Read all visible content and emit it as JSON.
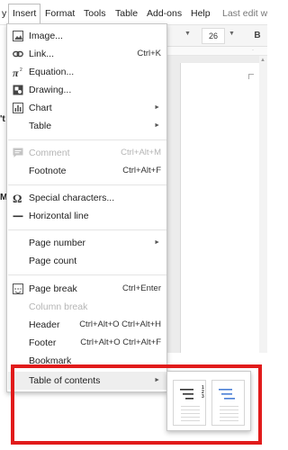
{
  "menubar": {
    "items": [
      {
        "label": "y"
      },
      {
        "label": "Insert"
      },
      {
        "label": "Format"
      },
      {
        "label": "Tools"
      },
      {
        "label": "Table"
      },
      {
        "label": "Add-ons"
      },
      {
        "label": "Help"
      }
    ],
    "last_edit": "Last edit wa"
  },
  "toolbar": {
    "font_size": "26",
    "bold": "B"
  },
  "background": {
    "left_frag_1": "'t",
    "left_frag_2": "M"
  },
  "insert_menu": {
    "items": [
      {
        "label": "Image...",
        "icon": "image-icon"
      },
      {
        "label": "Link...",
        "shortcut": "Ctrl+K",
        "icon": "link-icon"
      },
      {
        "label": "Equation...",
        "icon": "pi-icon"
      },
      {
        "label": "Drawing...",
        "icon": "drawing-icon"
      },
      {
        "label": "Chart",
        "icon": "chart-icon",
        "submenu": true
      },
      {
        "label": "Table",
        "submenu": true
      },
      {
        "label": "Comment",
        "shortcut": "Ctrl+Alt+M",
        "icon": "comment-icon",
        "disabled": true
      },
      {
        "label": "Footnote",
        "shortcut": "Ctrl+Alt+F"
      },
      {
        "label": "Special characters...",
        "icon": "omega-icon"
      },
      {
        "label": "Horizontal line",
        "icon": "horizontal-line-icon"
      },
      {
        "label": "Page number",
        "submenu": true
      },
      {
        "label": "Page count"
      },
      {
        "label": "Page break",
        "shortcut": "Ctrl+Enter",
        "icon": "page-break-icon"
      },
      {
        "label": "Column break",
        "disabled": true
      },
      {
        "label": "Header",
        "shortcut": "Ctrl+Alt+O Ctrl+Alt+H"
      },
      {
        "label": "Footer",
        "shortcut": "Ctrl+Alt+O Ctrl+Alt+F"
      },
      {
        "label": "Bookmark"
      },
      {
        "label": "Table of contents",
        "submenu": true,
        "highlighted": true
      }
    ],
    "submenu_arrow": "►"
  },
  "toc_submenu": {
    "options": [
      {
        "name": "toc-with-page-numbers",
        "numbers": [
          "1",
          "2",
          "3"
        ]
      },
      {
        "name": "toc-with-blue-links"
      }
    ]
  },
  "colors": {
    "highlight_frame": "#e11b1b",
    "link_blue": "#4a7fd6"
  }
}
